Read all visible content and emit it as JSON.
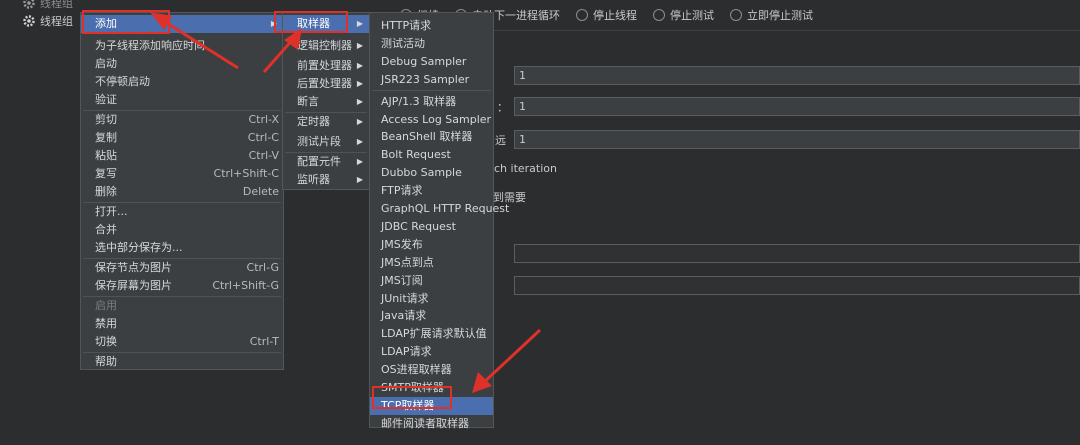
{
  "tree": {
    "top_item": "线程组",
    "selected_item": "线程组"
  },
  "panel": {
    "radios": [
      "继续",
      "启动下一进程循环",
      "停止线程",
      "停止测试",
      "立即停止测试"
    ],
    "fields": [
      {
        "label": "",
        "value": "1"
      },
      {
        "label": "：",
        "value": "1"
      },
      {
        "label": "远",
        "value": "1"
      }
    ],
    "iteration_text": "ch iteration",
    "need_text": "到需要"
  },
  "context_menu": {
    "items": [
      {
        "label": "添加",
        "shortcut": "",
        "submenu": true,
        "selected": true
      },
      {
        "label": "为子线程添加响应时间",
        "shortcut": ""
      },
      {
        "label": "启动",
        "shortcut": ""
      },
      {
        "label": "不停顿启动",
        "shortcut": ""
      },
      {
        "label": "验证",
        "shortcut": ""
      },
      {
        "label": "剪切",
        "shortcut": "Ctrl-X"
      },
      {
        "label": "复制",
        "shortcut": "Ctrl-C"
      },
      {
        "label": "粘贴",
        "shortcut": "Ctrl-V"
      },
      {
        "label": "复写",
        "shortcut": "Ctrl+Shift-C"
      },
      {
        "label": "删除",
        "shortcut": "Delete"
      },
      {
        "label": "打开...",
        "shortcut": ""
      },
      {
        "label": "合并",
        "shortcut": ""
      },
      {
        "label": "选中部分保存为...",
        "shortcut": ""
      },
      {
        "label": "保存节点为图片",
        "shortcut": "Ctrl-G"
      },
      {
        "label": "保存屏幕为图片",
        "shortcut": "Ctrl+Shift-G"
      },
      {
        "label": "启用",
        "shortcut": "",
        "disabled": true
      },
      {
        "label": "禁用",
        "shortcut": ""
      },
      {
        "label": "切换",
        "shortcut": "Ctrl-T"
      },
      {
        "label": "帮助",
        "shortcut": ""
      }
    ]
  },
  "add_menu": {
    "items": [
      "取样器",
      "逻辑控制器",
      "前置处理器",
      "后置处理器",
      "断言",
      "定时器",
      "测试片段",
      "配置元件",
      "监听器"
    ]
  },
  "sampler_menu": {
    "items": [
      "HTTP请求",
      "测试活动",
      "Debug Sampler",
      "JSR223 Sampler",
      "AJP/1.3 取样器",
      "Access Log Sampler",
      "BeanShell 取样器",
      "Bolt Request",
      "Dubbo Sample",
      "FTP请求",
      "GraphQL HTTP Request",
      "JDBC Request",
      "JMS发布",
      "JMS点到点",
      "JMS订阅",
      "JUnit请求",
      "Java请求",
      "LDAP扩展请求默认值",
      "LDAP请求",
      "OS进程取样器",
      "SMTP取样器",
      "TCP取样器",
      "邮件阅读者取样器"
    ],
    "selected": "TCP取样器"
  },
  "colors": {
    "highlight": "#4b6eaf",
    "annotation_red": "#e0302a"
  }
}
